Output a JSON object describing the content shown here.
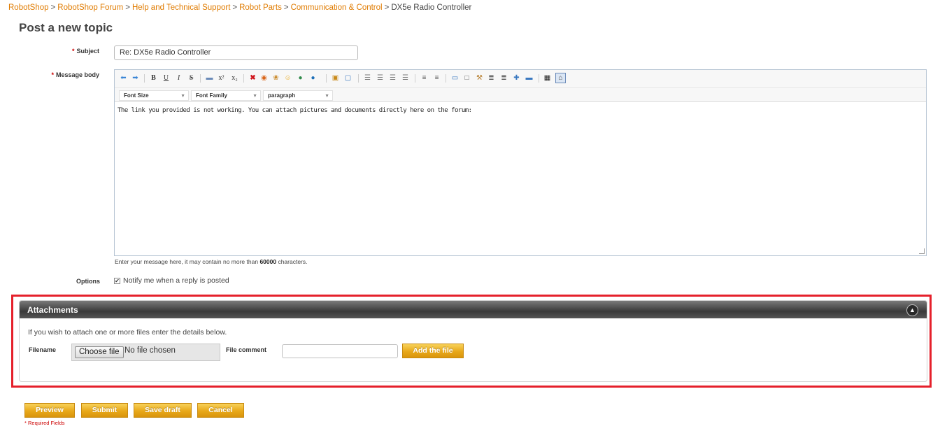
{
  "breadcrumb": {
    "items": [
      "RobotShop",
      "RobotShop Forum",
      "Help and Technical Support",
      "Robot Parts",
      "Communication & Control"
    ],
    "separator": ">",
    "current": "DX5e Radio Controller"
  },
  "page_title": "Post a new topic",
  "form": {
    "required_mark": "*",
    "subject_label": "Subject",
    "subject_value": "Re: DX5e Radio Controller",
    "message_label": "Message body",
    "editor": {
      "font_size_label": "Font Size",
      "font_family_label": "Font Family",
      "format_label": "paragraph",
      "content": "The link you provided is not working. You can attach pictures and documents directly here on the forum:"
    },
    "hint_prefix": "Enter your message here, it may contain no more than",
    "hint_limit": "60000",
    "hint_suffix": "characters.",
    "options_label": "Options",
    "notify_label": "Notify me when a reply is posted",
    "notify_checked": true
  },
  "attachments": {
    "title": "Attachments",
    "info": "If you wish to attach one or more files enter the details below.",
    "filename_label": "Filename",
    "choose_file_label": "Choose file",
    "no_file_text": "No file chosen",
    "file_comment_label": "File comment",
    "add_file_label": "Add the file"
  },
  "buttons": {
    "preview": "Preview",
    "submit": "Submit",
    "save_draft": "Save draft",
    "cancel": "Cancel"
  },
  "required_note": "* Required Fields",
  "colors": {
    "link": "#e07b00",
    "button": "#e8a81a",
    "highlight_frame": "#e5202b",
    "header_bar": "#3a3a3a"
  }
}
